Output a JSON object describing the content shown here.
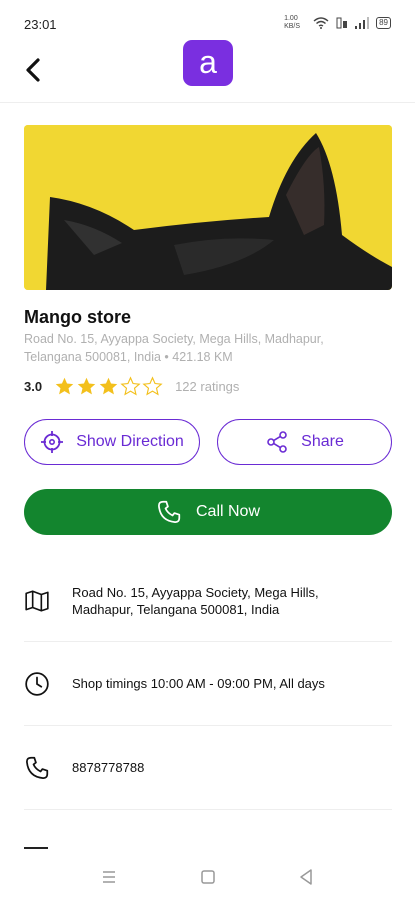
{
  "status": {
    "time": "23:01",
    "network": "1.00 KB/S",
    "battery": "89"
  },
  "header": {
    "logo_letter": "a"
  },
  "store": {
    "name": "Mango store",
    "address_summary": "Road No. 15, Ayyappa Society, Mega Hills, Madhapur, Telangana 500081, India • 421.18 KM",
    "rating": "3.0",
    "rating_fraction": 0.6,
    "rating_count": "122 ratings"
  },
  "actions": {
    "direction_label": "Show Direction",
    "share_label": "Share",
    "call_label": "Call Now"
  },
  "details": {
    "address": "Road No. 15, Ayyappa Society, Mega Hills, Madhapur, Telangana 500081, India",
    "timings": "Shop timings 10:00 AM - 09:00 PM, All days",
    "phone": "8878778788"
  },
  "colors": {
    "brand": "#7a2fe0",
    "accent": "#6a2bd4",
    "call": "#13852e",
    "star": "#f3c01c",
    "banner_bg": "#f1d732"
  }
}
